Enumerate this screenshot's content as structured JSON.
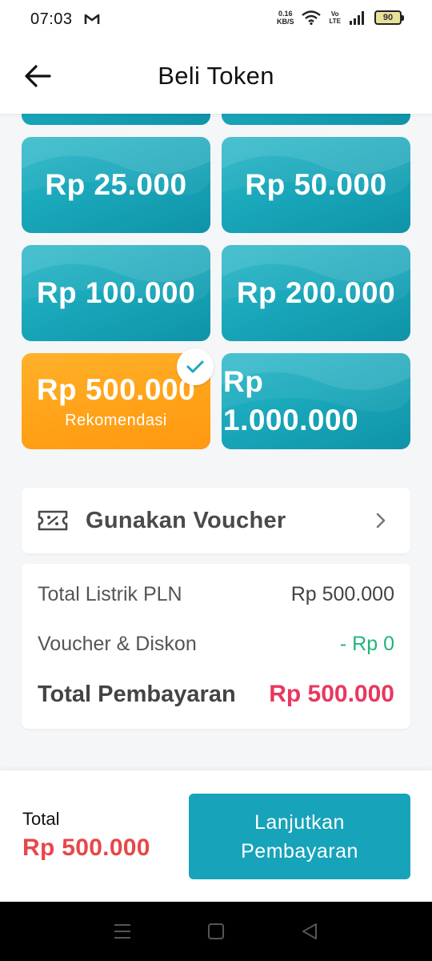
{
  "status_bar": {
    "time": "07:03",
    "net_speed_value": "0.16",
    "net_speed_unit": "KB/S",
    "volte_top": "Vo",
    "volte_bottom": "LTE",
    "battery_level": "90"
  },
  "header": {
    "title": "Beli Token"
  },
  "denominations": [
    {
      "amount": "Rp 25.000"
    },
    {
      "amount": "Rp 50.000"
    },
    {
      "amount": "Rp 100.000"
    },
    {
      "amount": "Rp 200.000"
    },
    {
      "amount": "Rp 500.000",
      "sub": "Rekomendasi",
      "selected": true
    },
    {
      "amount_line1": "Rp",
      "amount_line2": "1.000.000"
    }
  ],
  "voucher": {
    "label": "Gunakan Voucher"
  },
  "summary": {
    "total_listrik_label": "Total Listrik PLN",
    "total_listrik_value": "Rp 500.000",
    "voucher_label": "Voucher & Diskon",
    "voucher_value": "- Rp 0",
    "total_label": "Total Pembayaran",
    "total_value": "Rp 500.000"
  },
  "bottom": {
    "total_label": "Total",
    "total_value": "Rp 500.000",
    "button_line1": "Lanjutkan",
    "button_line2": "Pembayaran"
  },
  "colors": {
    "card_teal": "#1aa8bb",
    "card_selected": "#ffa41a",
    "total_red": "#e8385f",
    "discount_green": "#1fb57a",
    "button_teal": "#17a3b9"
  },
  "icons": [
    "gmail-icon",
    "wifi-icon",
    "signal-icon",
    "battery-icon",
    "back-arrow-icon",
    "check-icon",
    "voucher-icon",
    "chevron-right-icon",
    "nav-menu-icon",
    "nav-home-icon",
    "nav-back-icon"
  ]
}
